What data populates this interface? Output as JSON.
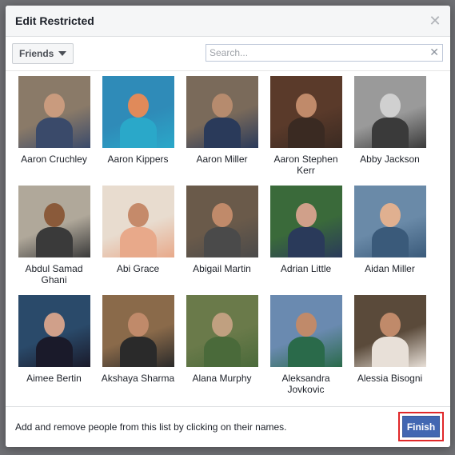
{
  "dialog": {
    "title": "Edit Restricted",
    "close_icon": "close-icon"
  },
  "toolbar": {
    "filter_label": "Friends",
    "search_placeholder": "Search...",
    "search_value": ""
  },
  "people": [
    {
      "name": "Aaron Cruchley"
    },
    {
      "name": "Aaron Kippers"
    },
    {
      "name": "Aaron Miller"
    },
    {
      "name": "Aaron Stephen Kerr"
    },
    {
      "name": "Abby Jackson"
    },
    {
      "name": "Abdul Samad Ghani"
    },
    {
      "name": "Abi Grace"
    },
    {
      "name": "Abigail Martin"
    },
    {
      "name": "Adrian Little"
    },
    {
      "name": "Aidan Miller"
    },
    {
      "name": "Aimee Bertin"
    },
    {
      "name": "Akshaya Sharma"
    },
    {
      "name": "Alana Murphy"
    },
    {
      "name": "Aleksandra Jovkovic"
    },
    {
      "name": "Alessia Bisogni"
    }
  ],
  "footer": {
    "hint": "Add and remove people from this list by clicking on their names.",
    "finish_label": "Finish"
  },
  "colors": {
    "accent": "#4267b2",
    "highlight": "#e0282a"
  }
}
